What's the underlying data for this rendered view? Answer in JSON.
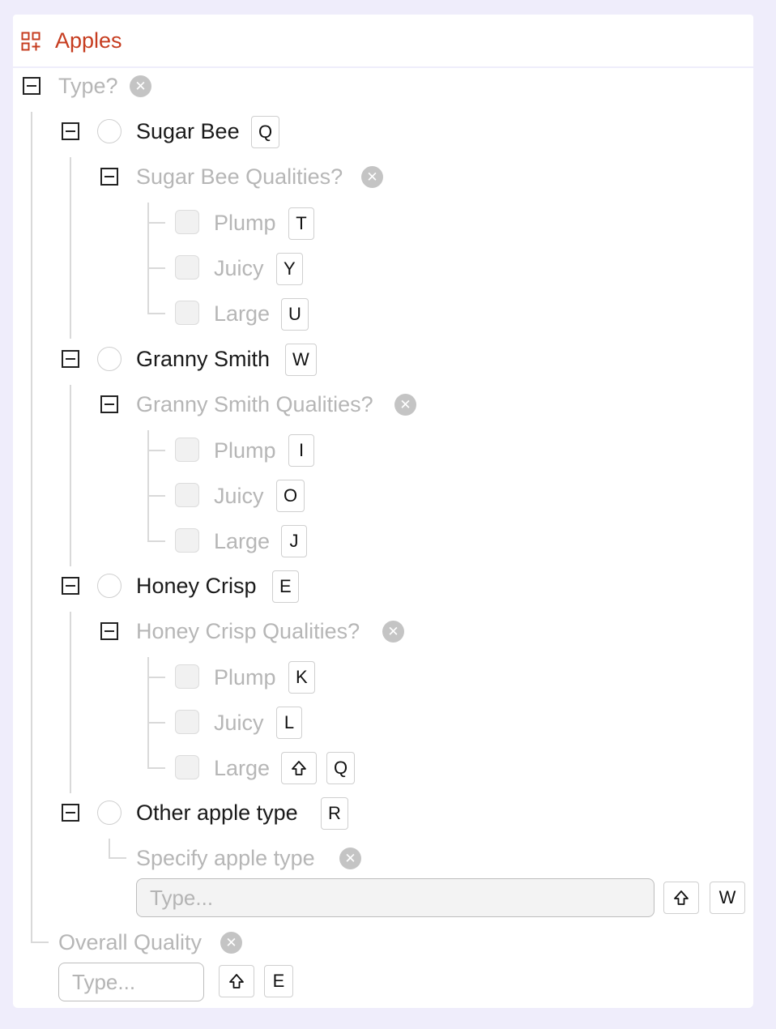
{
  "header": {
    "title": "Apples"
  },
  "type_question": {
    "label": "Type?",
    "clear": "✕"
  },
  "options": [
    {
      "label": "Sugar Bee",
      "key": "Q",
      "qualities_label": "Sugar Bee Qualities?",
      "qualities": [
        {
          "label": "Plump",
          "key": "T"
        },
        {
          "label": "Juicy",
          "key": "Y"
        },
        {
          "label": "Large",
          "key": "U"
        }
      ]
    },
    {
      "label": "Granny Smith",
      "key": "W",
      "qualities_label": "Granny Smith Qualities?",
      "qualities": [
        {
          "label": "Plump",
          "key": "I"
        },
        {
          "label": "Juicy",
          "key": "O"
        },
        {
          "label": "Large",
          "key": "J"
        }
      ]
    },
    {
      "label": "Honey Crisp",
      "key": "E",
      "qualities_label": "Honey Crisp Qualities?",
      "qualities": [
        {
          "label": "Plump",
          "key": "K"
        },
        {
          "label": "Juicy",
          "key": "L"
        },
        {
          "label": "Large",
          "key": "Q",
          "shift": true
        }
      ]
    },
    {
      "label": "Other apple type",
      "key": "R",
      "specify": {
        "label": "Specify apple type",
        "placeholder": "Type...",
        "value": "",
        "key": "W",
        "shift": true
      }
    }
  ],
  "overall_quality": {
    "label": "Overall Quality",
    "placeholder": "Type...",
    "value": "",
    "key": "E",
    "shift": true
  }
}
